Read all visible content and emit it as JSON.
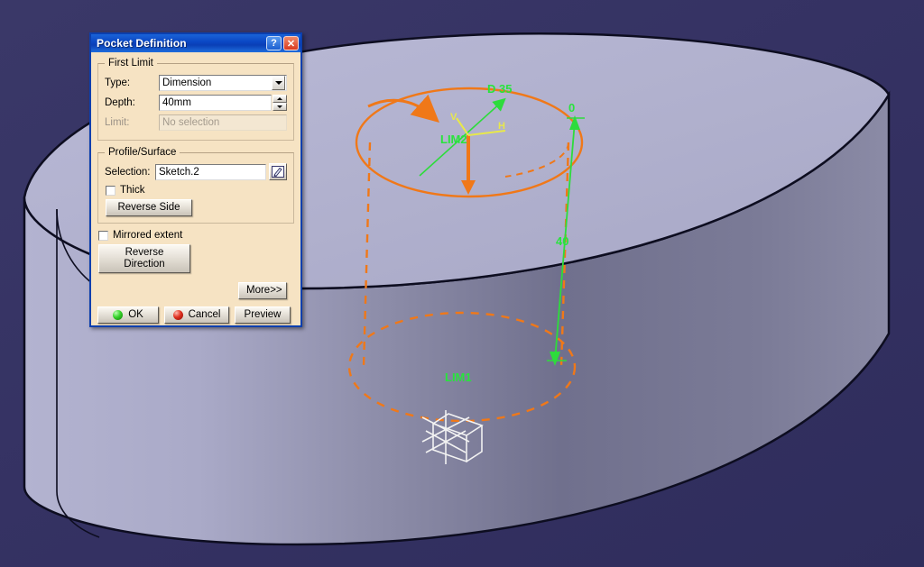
{
  "app": {
    "background_color": "#363469",
    "product": "CAD 3D modeler"
  },
  "dialog": {
    "title": "Pocket Definition",
    "help_button": "?",
    "close_button": "✕",
    "first_limit": {
      "legend": "First Limit",
      "type_label": "Type:",
      "type_value": "Dimension",
      "type_options": [
        "Dimension"
      ],
      "depth_label": "Depth:",
      "depth_value": "40mm",
      "limit_label": "Limit:",
      "limit_placeholder": "No selection",
      "limit_value": "No selection"
    },
    "profile_surface": {
      "legend": "Profile/Surface",
      "selection_label": "Selection:",
      "selection_value": "Sketch.2",
      "selection_icon": "sketch-pencil-icon",
      "thick_label": "Thick",
      "thick_checked": false,
      "reverse_side_label": "Reverse Side"
    },
    "mirrored_extent_label": "Mirrored extent",
    "mirrored_extent_checked": false,
    "reverse_direction_label": "Reverse Direction",
    "more_label": "More>>",
    "footer": {
      "ok_label": "OK",
      "cancel_label": "Cancel",
      "preview_label": "Preview",
      "ok_orb_color": "#36d22a",
      "cancel_orb_color": "#e03020"
    }
  },
  "viewport": {
    "solid": {
      "top_face_color": "#b2b2cf",
      "side_face_color": "#6e6e8c",
      "edge_color": "#0d0d20"
    },
    "sketch_color": "#f07818",
    "dimension_color": "#2ddc3c",
    "axis_color": "#e8e84a",
    "annotations": [
      {
        "name": "diameter-dimension",
        "text": "D 35",
        "color": "#2ddc3c"
      },
      {
        "name": "depth-dimension",
        "text": "40",
        "color": "#2ddc3c"
      },
      {
        "name": "depth-origin",
        "text": "0",
        "color": "#2ddc3c"
      },
      {
        "name": "limit2-label",
        "text": "LIM2",
        "color": "#2ddc3c"
      },
      {
        "name": "limit1-label",
        "text": "LIM1",
        "color": "#2ddc3c"
      },
      {
        "name": "sketch-axis-h",
        "text": "H",
        "color": "#e8e84a"
      },
      {
        "name": "sketch-axis-v",
        "text": "V",
        "color": "#e8e84a"
      }
    ],
    "compass": "axis-system-icon"
  }
}
